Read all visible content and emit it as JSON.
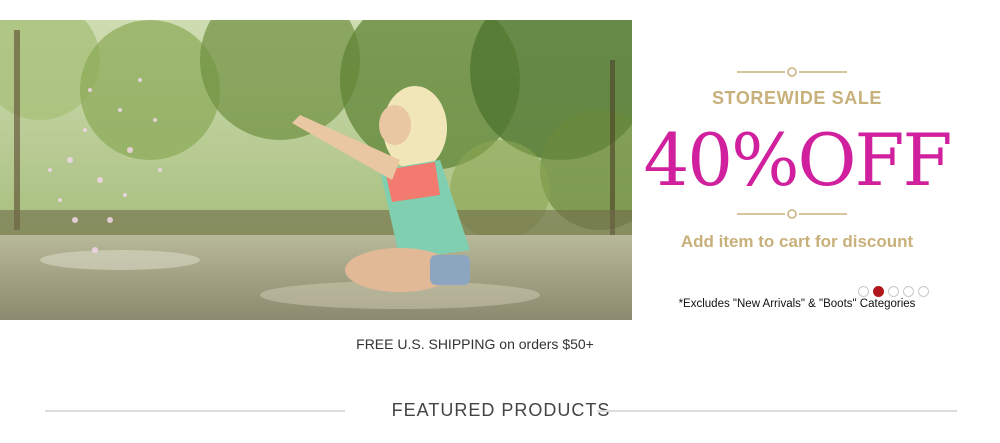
{
  "hero": {
    "image_alt": "Blonde woman in coral and mint top crouching in a river, splashing water",
    "colors": {
      "foliage": "#7d9a45",
      "water": "#a4a48c",
      "top_coral": "#f37a6e",
      "top_mint": "#7fcfb0"
    }
  },
  "promo": {
    "kicker": "STOREWIDE SALE",
    "headline": "40%OFF",
    "subtext": "Add item to cart for discount",
    "note": "*Excludes \"New Arrivals\" & \"Boots\" Categories",
    "colors": {
      "headline": "#d0209d",
      "gold": "#c8b07b",
      "active_dot": "#b0161c"
    }
  },
  "carousel": {
    "slide_count": 5,
    "active_index": 1
  },
  "shipping_text": "FREE U.S. SHIPPING on orders $50+",
  "featured_title": "FEATURED PRODUCTS"
}
